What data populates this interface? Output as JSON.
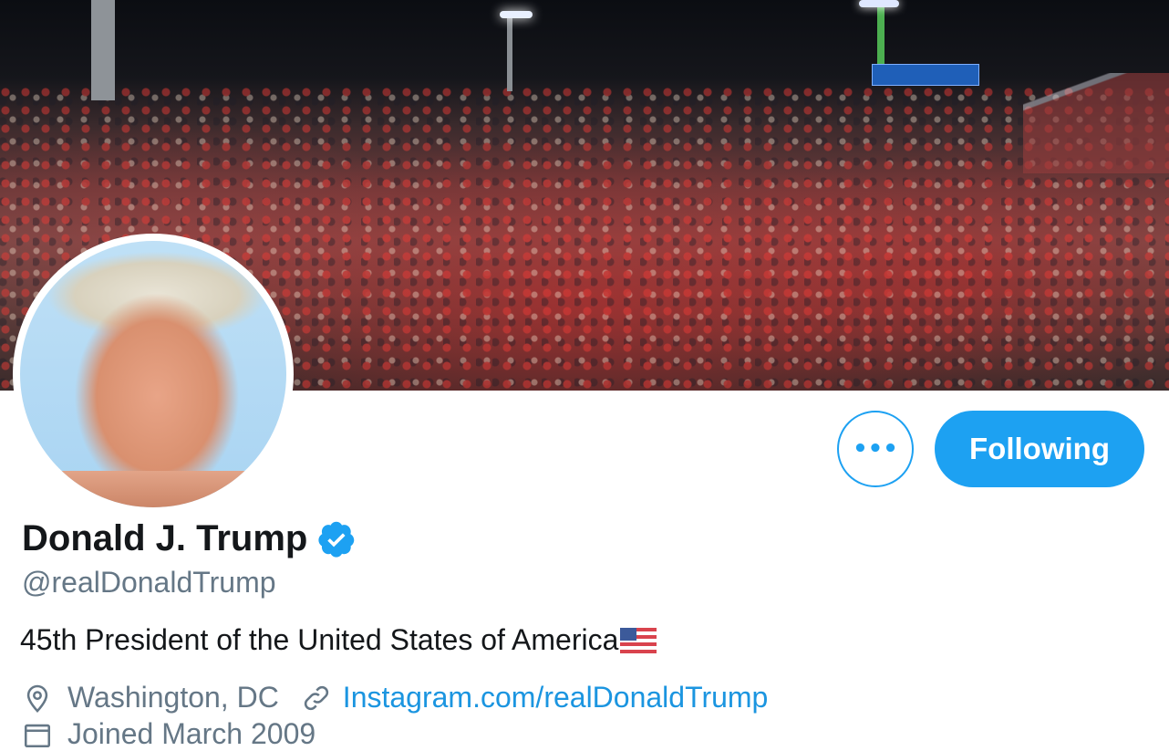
{
  "profile": {
    "name": "Donald J. Trump",
    "handle": "@realDonaldTrump",
    "bio": "45th President of the United States of America",
    "location": "Washington, DC",
    "url": "Instagram.com/realDonaldTrump",
    "joined": "Joined March 2009",
    "verified": true
  },
  "actions": {
    "more_label": "•••",
    "follow_label": "Following"
  },
  "icons": {
    "verified": "verified-badge-icon",
    "flag": "us-flag-icon",
    "location": "location-pin-icon",
    "link": "link-icon",
    "calendar": "calendar-icon",
    "more": "more-options-icon"
  },
  "colors": {
    "accent": "#1da1f2",
    "link": "#1b95e0",
    "secondary_text": "#657786",
    "primary_text": "#14171a"
  }
}
